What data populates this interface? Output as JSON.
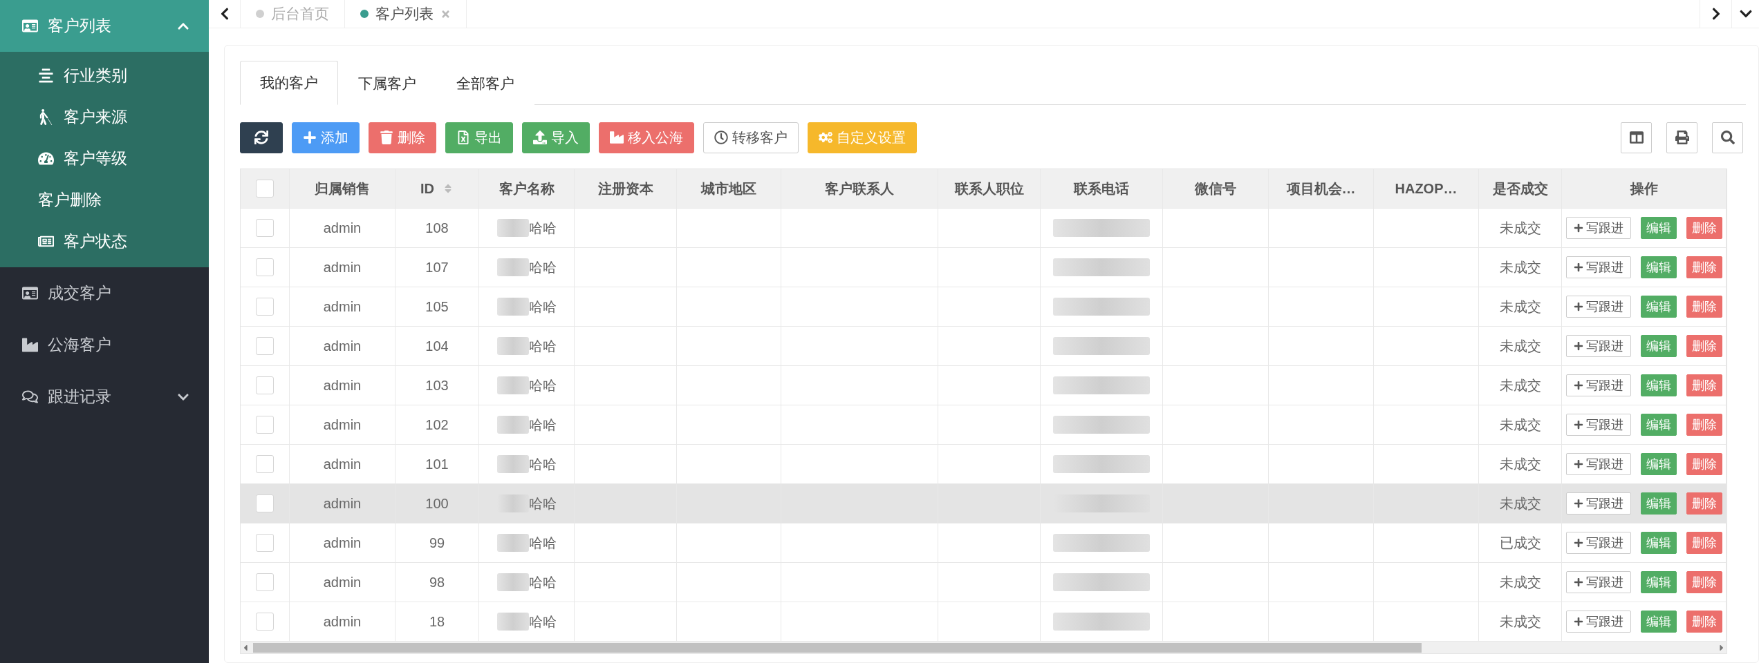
{
  "sidebar": {
    "items": [
      {
        "label": "客户列表",
        "expanded": true,
        "children": [
          {
            "label": "行业类别"
          },
          {
            "label": "客户来源"
          },
          {
            "label": "客户等级"
          },
          {
            "label": "客户删除"
          },
          {
            "label": "客户状态"
          }
        ]
      },
      {
        "label": "成交客户"
      },
      {
        "label": "公海客户"
      },
      {
        "label": "跟进记录",
        "expanded": false
      }
    ]
  },
  "page_tabs": [
    {
      "label": "后台首页",
      "selected": false,
      "closable": false
    },
    {
      "label": "客户列表",
      "selected": true,
      "closable": true
    }
  ],
  "content_tabs": [
    {
      "label": "我的客户",
      "selected": true
    },
    {
      "label": "下属客户",
      "selected": false
    },
    {
      "label": "全部客户",
      "selected": false
    }
  ],
  "toolbar": [
    {
      "kind": "dark"
    },
    {
      "kind": "primary",
      "label": "添加"
    },
    {
      "kind": "danger",
      "label": "删除"
    },
    {
      "kind": "success",
      "label": "导出"
    },
    {
      "kind": "success",
      "label": "导入"
    },
    {
      "kind": "danger",
      "label": "移入公海"
    },
    {
      "kind": "default",
      "label": "转移客户"
    },
    {
      "kind": "warning",
      "label": "自定义设置"
    }
  ],
  "table": {
    "all_checked": false,
    "columns": [
      {
        "label": "归属销售",
        "sortable": false
      },
      {
        "label": "ID",
        "sortable": true
      },
      {
        "label": "客户名称",
        "sortable": false
      },
      {
        "label": "注册资本",
        "sortable": false
      },
      {
        "label": "城市地区",
        "sortable": false
      },
      {
        "label": "客户联系人",
        "sortable": false
      },
      {
        "label": "联系人职位",
        "sortable": false
      },
      {
        "label": "联系电话",
        "sortable": false
      },
      {
        "label": "微信号",
        "sortable": false
      },
      {
        "label": "项目机会…",
        "sortable": false
      },
      {
        "label": "HAZOP…",
        "sortable": false
      },
      {
        "label": "是否成交",
        "sortable": false
      },
      {
        "label": "操作",
        "sortable": false
      }
    ],
    "rows": [
      {
        "checked": false,
        "hovered": false,
        "owner": "admin",
        "id": "108",
        "name": "哈哈",
        "status": "未成交",
        "actions": [
          "写跟进",
          "编辑",
          "删除"
        ]
      },
      {
        "checked": false,
        "hovered": false,
        "owner": "admin",
        "id": "107",
        "name": "哈哈",
        "status": "未成交",
        "actions": [
          "写跟进",
          "编辑",
          "删除"
        ]
      },
      {
        "checked": false,
        "hovered": false,
        "owner": "admin",
        "id": "105",
        "name": "哈哈",
        "status": "未成交",
        "actions": [
          "写跟进",
          "编辑",
          "删除"
        ]
      },
      {
        "checked": false,
        "hovered": false,
        "owner": "admin",
        "id": "104",
        "name": "哈哈",
        "status": "未成交",
        "actions": [
          "写跟进",
          "编辑",
          "删除"
        ]
      },
      {
        "checked": false,
        "hovered": false,
        "owner": "admin",
        "id": "103",
        "name": "哈哈",
        "status": "未成交",
        "actions": [
          "写跟进",
          "编辑",
          "删除"
        ]
      },
      {
        "checked": false,
        "hovered": false,
        "owner": "admin",
        "id": "102",
        "name": "哈哈",
        "status": "未成交",
        "actions": [
          "写跟进",
          "编辑",
          "删除"
        ]
      },
      {
        "checked": false,
        "hovered": false,
        "owner": "admin",
        "id": "101",
        "name": "哈哈",
        "status": "未成交",
        "actions": [
          "写跟进",
          "编辑",
          "删除"
        ]
      },
      {
        "checked": false,
        "hovered": true,
        "owner": "admin",
        "id": "100",
        "name": "哈哈",
        "status": "未成交",
        "actions": [
          "写跟进",
          "编辑",
          "删除"
        ]
      },
      {
        "checked": false,
        "hovered": false,
        "owner": "admin",
        "id": "99",
        "name": "哈哈",
        "status": "已成交",
        "actions": [
          "写跟进",
          "编辑",
          "删除"
        ]
      },
      {
        "checked": false,
        "hovered": false,
        "owner": "admin",
        "id": "98",
        "name": "哈哈",
        "status": "未成交",
        "actions": [
          "写跟进",
          "编辑",
          "删除"
        ]
      },
      {
        "checked": false,
        "hovered": false,
        "owner": "admin",
        "id": "18",
        "name": "哈哈",
        "status": "未成交",
        "actions": [
          "写跟进",
          "编辑",
          "删除"
        ]
      }
    ]
  }
}
